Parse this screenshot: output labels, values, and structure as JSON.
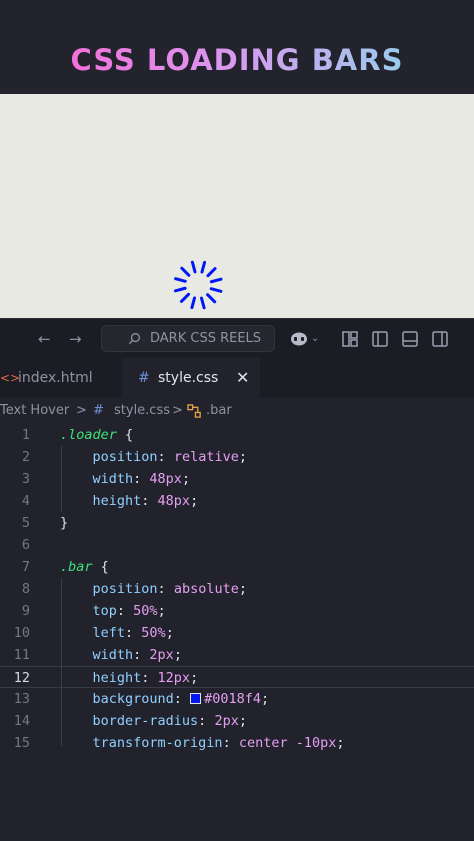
{
  "banner": {
    "title": "CSS LOADING BARS"
  },
  "colors": {
    "spinner": "#0018f4",
    "background": "#1f1f28",
    "preview_bg": "#e9e9e4"
  },
  "titlebar": {
    "back_icon": "arrow-left-icon",
    "forward_icon": "arrow-right-icon",
    "search_text": "DARK CSS REELS"
  },
  "tabs": [
    {
      "label": "index.html",
      "icon": "html-icon"
    },
    {
      "label": "style.css",
      "icon": "hash-icon",
      "close": "✕"
    }
  ],
  "breadcrumb": [
    "Text Hover",
    ">",
    "#",
    "style.css",
    ">",
    ".bar"
  ],
  "editor": {
    "active_line": 12,
    "lines": [
      {
        "n": "1",
        "parts": [
          [
            ".loader",
            "sel"
          ],
          [
            " {",
            "brace"
          ]
        ]
      },
      {
        "n": "2",
        "parts": [
          [
            "    position",
            "prop"
          ],
          [
            ": ",
            "punc"
          ],
          [
            "relative",
            "val"
          ],
          [
            ";",
            "punc"
          ]
        ]
      },
      {
        "n": "3",
        "parts": [
          [
            "    width",
            "prop"
          ],
          [
            ": ",
            "punc"
          ],
          [
            "48px",
            "num"
          ],
          [
            ";",
            "punc"
          ]
        ]
      },
      {
        "n": "4",
        "parts": [
          [
            "    height",
            "prop"
          ],
          [
            ": ",
            "punc"
          ],
          [
            "48px",
            "num"
          ],
          [
            ";",
            "punc"
          ]
        ]
      },
      {
        "n": "5",
        "parts": [
          [
            "}",
            "brace"
          ]
        ]
      },
      {
        "n": "6",
        "parts": []
      },
      {
        "n": "7",
        "parts": [
          [
            ".bar",
            "sel"
          ],
          [
            " {",
            "brace"
          ]
        ]
      },
      {
        "n": "8",
        "parts": [
          [
            "    position",
            "prop"
          ],
          [
            ": ",
            "punc"
          ],
          [
            "absolute",
            "val"
          ],
          [
            ";",
            "punc"
          ]
        ]
      },
      {
        "n": "9",
        "parts": [
          [
            "    top",
            "prop"
          ],
          [
            ": ",
            "punc"
          ],
          [
            "50%",
            "num"
          ],
          [
            ";",
            "punc"
          ]
        ]
      },
      {
        "n": "10",
        "parts": [
          [
            "    left",
            "prop"
          ],
          [
            ": ",
            "punc"
          ],
          [
            "50%",
            "num"
          ],
          [
            ";",
            "punc"
          ]
        ]
      },
      {
        "n": "11",
        "parts": [
          [
            "    width",
            "prop"
          ],
          [
            ": ",
            "punc"
          ],
          [
            "2px",
            "num"
          ],
          [
            ";",
            "punc"
          ]
        ]
      },
      {
        "n": "12",
        "parts": [
          [
            "    height",
            "prop"
          ],
          [
            ": ",
            "punc"
          ],
          [
            "12px",
            "num"
          ],
          [
            ";",
            "punc"
          ]
        ]
      },
      {
        "n": "13",
        "parts": [
          [
            "    background",
            "prop"
          ],
          [
            ": ",
            "punc"
          ],
          [
            "SWATCH",
            "swatch"
          ],
          [
            "#0018f4",
            "val"
          ],
          [
            ";",
            "punc"
          ]
        ]
      },
      {
        "n": "14",
        "parts": [
          [
            "    border-radius",
            "prop"
          ],
          [
            ": ",
            "punc"
          ],
          [
            "2px",
            "num"
          ],
          [
            ";",
            "punc"
          ]
        ]
      },
      {
        "n": "15",
        "parts": [
          [
            "    transform-origin",
            "prop"
          ],
          [
            ": ",
            "punc"
          ],
          [
            "center -10px",
            "val"
          ],
          [
            ";",
            "punc"
          ]
        ]
      }
    ]
  }
}
